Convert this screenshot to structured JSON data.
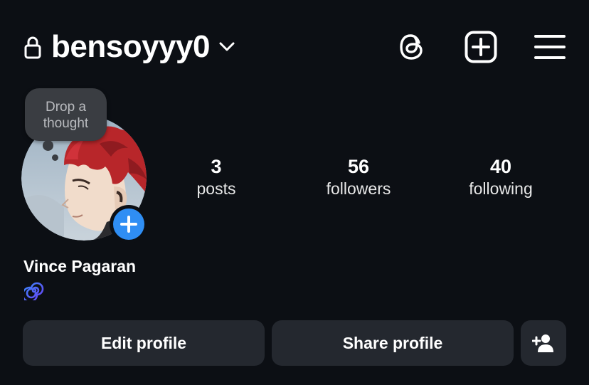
{
  "header": {
    "username": "bensoyyy0",
    "icons": [
      "lock-icon",
      "chevron-down-icon",
      "threads-icon",
      "create-post-icon",
      "menu-icon"
    ]
  },
  "note": {
    "text": "Drop a thought"
  },
  "avatar": {
    "icon": "avatar",
    "add_story_icon": "plus-icon"
  },
  "stats": [
    {
      "value": "3",
      "label": "posts"
    },
    {
      "value": "56",
      "label": "followers"
    },
    {
      "value": "40",
      "label": "following"
    }
  ],
  "profile": {
    "display_name": "Vince Pagaran",
    "bio_emoji_icon": "spiral-icon"
  },
  "actions": {
    "edit_label": "Edit profile",
    "share_label": "Share profile",
    "add_user_icon": "add-person-icon"
  },
  "colors": {
    "background": "#0c0f14",
    "button": "#24282f",
    "accent": "#2f8ef4",
    "note_bubble": "#3a3d42"
  }
}
